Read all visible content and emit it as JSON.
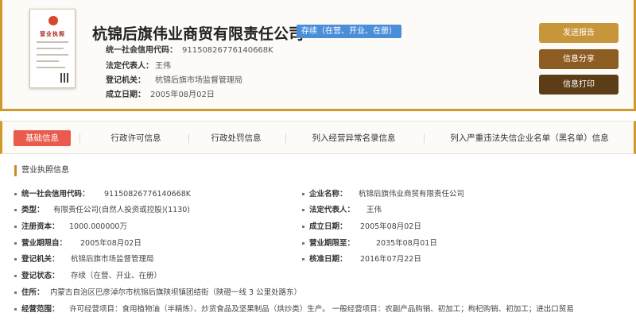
{
  "header": {
    "license_thumb": {
      "title": "营业执照"
    },
    "company_name": "杭锦后旗伟业商贸有限责任公司",
    "status_tag": "存续（在营、开业、在册）",
    "rows": [
      {
        "label": "统一社会信用代码：",
        "value": "91150826776140668K"
      },
      {
        "label": "法定代表人：",
        "value": "王伟"
      },
      {
        "label": "登记机关：",
        "value": "杭锦后旗市场监督管理局"
      },
      {
        "label": "成立日期：",
        "value": "2005年08月02日"
      }
    ],
    "buttons": {
      "report": "发送报告",
      "share": "信息分享",
      "print": "信息打印"
    }
  },
  "tabs": [
    {
      "label": "基础信息",
      "active": true
    },
    {
      "label": "行政许可信息",
      "active": false
    },
    {
      "label": "行政处罚信息",
      "active": false
    },
    {
      "label": "列入经营异常名录信息",
      "active": false
    },
    {
      "label": "列入严重违法失信企业名单（黑名单）信息",
      "active": false
    }
  ],
  "details": {
    "section_title": "营业执照信息",
    "credit_code": {
      "label": "统一社会信用代码：",
      "value": "91150826776140668K"
    },
    "enterprise_name": {
      "label": "企业名称：",
      "value": "杭锦后旗伟业商贸有限责任公司"
    },
    "type": {
      "label": "类型：",
      "value": "有限责任公司(自然人投资或控股)(1130)"
    },
    "legal_rep": {
      "label": "法定代表人：",
      "value": "王伟"
    },
    "capital": {
      "label": "注册资本：",
      "value": "1000.000000万"
    },
    "established": {
      "label": "成立日期：",
      "value": "2005年08月02日"
    },
    "term_from": {
      "label": "营业期限自：",
      "value": "2005年08月02日"
    },
    "term_to": {
      "label": "营业期限至：",
      "value": "2035年08月01日"
    },
    "authority": {
      "label": "登记机关：",
      "value": "杭锦后旗市场监督管理局"
    },
    "approved": {
      "label": "核准日期：",
      "value": "2016年07月22日"
    },
    "status": {
      "label": "登记状态：",
      "value": "存续（在营、开业、在册）"
    },
    "address": {
      "label": "住所：",
      "value": "内蒙古自治区巴彦淖尔市杭锦后旗陕坝镇团结街（陕磴一线 3 公里处路东）"
    },
    "scope": {
      "label": "经营范围：",
      "value": "许可经营项目：食用植物油（半精炼）、炒货食品及坚果制品（烘炒类）生产。 一般经营项目：农副产品购销、初加工；枸杞购销、初加工；进出口贸易"
    }
  }
}
